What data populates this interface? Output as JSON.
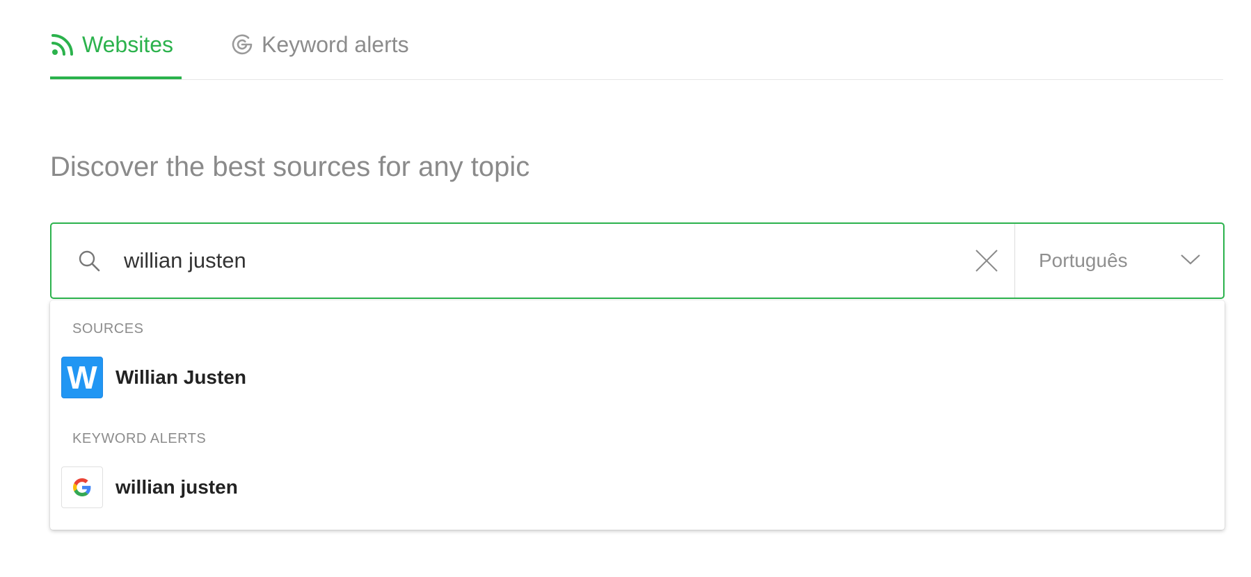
{
  "tabs": [
    {
      "label": "Websites",
      "icon": "rss-icon",
      "active": true,
      "color": "#2bb24c"
    },
    {
      "label": "Keyword alerts",
      "icon": "google-g-outline-icon",
      "active": false,
      "color": "#8c8c8c"
    }
  ],
  "heading": "Discover the best sources for any topic",
  "search": {
    "value": "willian justen",
    "language": "Português",
    "border_color": "#2bb24c"
  },
  "dropdown": {
    "sources_header": "SOURCES",
    "sources": [
      {
        "label": "Willian Justen",
        "icon_letter": "W",
        "icon_color": "#2196f3"
      }
    ],
    "keyword_header": "KEYWORD ALERTS",
    "keywords": [
      {
        "label": "willian justen",
        "icon": "google-icon"
      }
    ]
  }
}
